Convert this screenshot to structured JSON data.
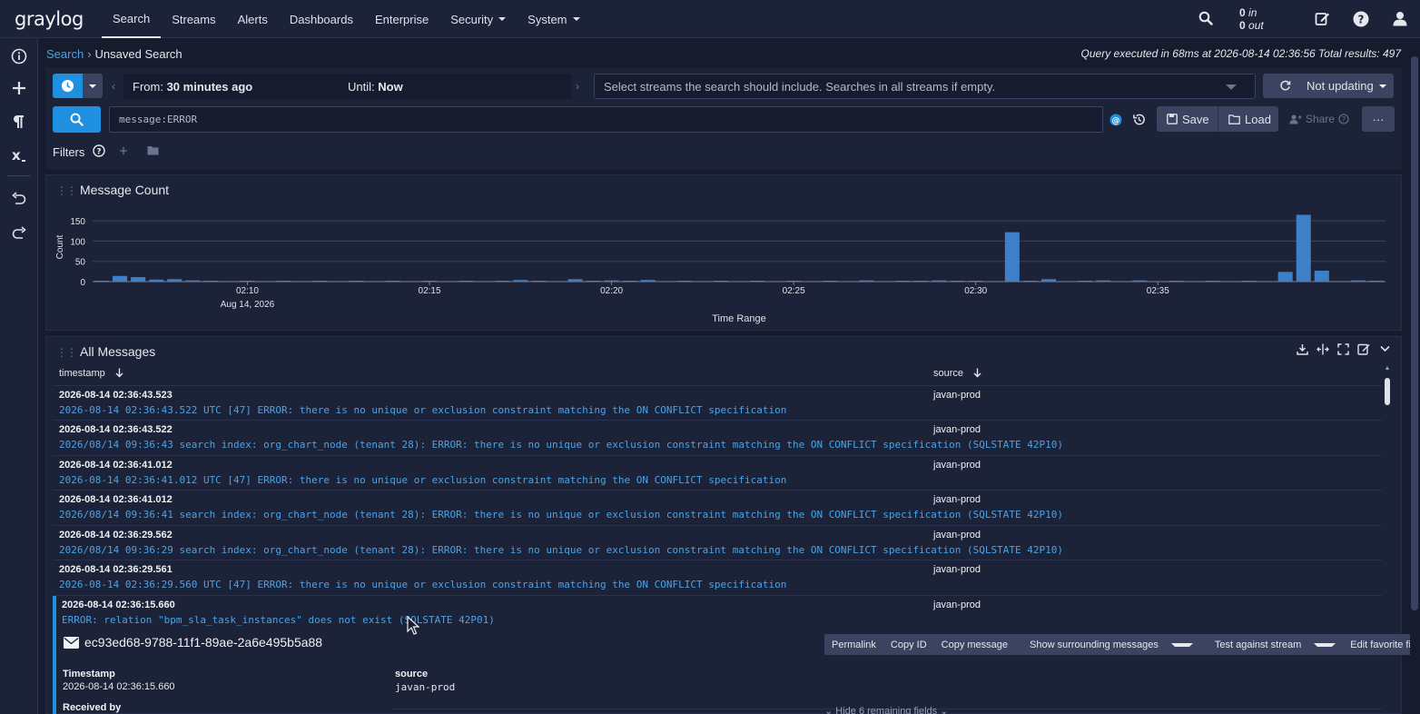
{
  "nav": {
    "logo": "graylog",
    "items": [
      {
        "label": "Search",
        "active": true
      },
      {
        "label": "Streams"
      },
      {
        "label": "Alerts"
      },
      {
        "label": "Dashboards"
      },
      {
        "label": "Enterprise"
      },
      {
        "label": "Security",
        "dropdown": true
      },
      {
        "label": "System",
        "dropdown": true
      }
    ],
    "throughput_in": "0",
    "throughput_in_label": "in",
    "throughput_out": "0",
    "throughput_out_label": "out"
  },
  "breadcrumb": {
    "root": "Search",
    "current": "Unsaved Search"
  },
  "query_info": "Query executed in 68ms at 2026-08-14 02:36:56 Total results: 497",
  "search": {
    "from_label": "From:",
    "from_value": "30 minutes ago",
    "until_label": "Until:",
    "until_value": "Now",
    "streams_placeholder": "Select streams the search should include. Searches in all streams if empty.",
    "refresh_label": "Not updating",
    "query": "message:ERROR",
    "save_label": "Save",
    "load_label": "Load",
    "share_label": "Share",
    "more_label": "···",
    "filters_label": "Filters"
  },
  "message_count": {
    "title": "Message Count"
  },
  "chart_data": {
    "type": "bar",
    "title": "Message Count",
    "xlabel": "Time Range",
    "ylabel": "Count",
    "ylim": [
      0,
      175
    ],
    "yticks": [
      0,
      50,
      100,
      150
    ],
    "xtick_labels": [
      "02:10",
      "02:15",
      "02:20",
      "02:25",
      "02:30",
      "02:35"
    ],
    "date_label": "Aug 14, 2026",
    "values": [
      2,
      14,
      11,
      5,
      6,
      3,
      2,
      0,
      2,
      0,
      2,
      0,
      2,
      0,
      2,
      0,
      2,
      0,
      2,
      0,
      2,
      0,
      2,
      4,
      2,
      0,
      6,
      2,
      3,
      2,
      4,
      0,
      2,
      0,
      2,
      0,
      2,
      0,
      2,
      0,
      2,
      0,
      3,
      0,
      2,
      2,
      3,
      2,
      2,
      0,
      122,
      2,
      6,
      0,
      2,
      3,
      0,
      3,
      0,
      2,
      0,
      2,
      0,
      2,
      0,
      24,
      165,
      27,
      0,
      3,
      2
    ],
    "color": "#3f7fc7"
  },
  "messages": {
    "title": "All Messages",
    "col_timestamp": "timestamp",
    "col_source": "source",
    "rows": [
      {
        "ts": "2026-08-14 02:36:43.523",
        "src": "javan-prod",
        "msg": "2026-08-14 02:36:43.522 UTC [47] ERROR: there is no unique or exclusion constraint matching the ON CONFLICT specification"
      },
      {
        "ts": "2026-08-14 02:36:43.522",
        "src": "javan-prod",
        "msg": "2026/08/14 09:36:43 search index: org_chart_node (tenant 28): ERROR: there is no unique or exclusion constraint matching the ON CONFLICT specification (SQLSTATE 42P10)"
      },
      {
        "ts": "2026-08-14 02:36:41.012",
        "src": "javan-prod",
        "msg": "2026-08-14 02:36:41.012 UTC [47] ERROR: there is no unique or exclusion constraint matching the ON CONFLICT specification"
      },
      {
        "ts": "2026-08-14 02:36:41.012",
        "src": "javan-prod",
        "msg": "2026/08/14 09:36:41 search index: org_chart_node (tenant 28): ERROR: there is no unique or exclusion constraint matching the ON CONFLICT specification (SQLSTATE 42P10)"
      },
      {
        "ts": "2026-08-14 02:36:29.562",
        "src": "javan-prod",
        "msg": "2026/08/14 09:36:29 search index: org_chart_node (tenant 28): ERROR: there is no unique or exclusion constraint matching the ON CONFLICT specification (SQLSTATE 42P10)"
      },
      {
        "ts": "2026-08-14 02:36:29.561",
        "src": "javan-prod",
        "msg": "2026-08-14 02:36:29.560 UTC [47] ERROR: there is no unique or exclusion constraint matching the ON CONFLICT specification"
      },
      {
        "ts": "2026-08-14 02:36:15.660",
        "src": "javan-prod",
        "msg": "ERROR: relation \"bpm_sla_task_instances\" does not exist (SQLSTATE 42P01)"
      }
    ]
  },
  "detail": {
    "id": "ec93ed68-9788-11f1-89ae-2a6e495b5a88",
    "actions": [
      "Permalink",
      "Copy ID",
      "Copy message",
      "Show surrounding messages",
      "Test against stream",
      "Edit favorite fields"
    ],
    "timestamp_label": "Timestamp",
    "timestamp_value": "2026-08-14 02:36:15.660",
    "source_label": "source",
    "source_value": "javan-prod",
    "received_label": "Received by",
    "hide_fields": "Hide 6 remaining fields"
  },
  "colors": {
    "accent": "#1f8fe0",
    "link": "#4aa3e6",
    "bg": "#161b2d",
    "panel": "#1c2237"
  }
}
